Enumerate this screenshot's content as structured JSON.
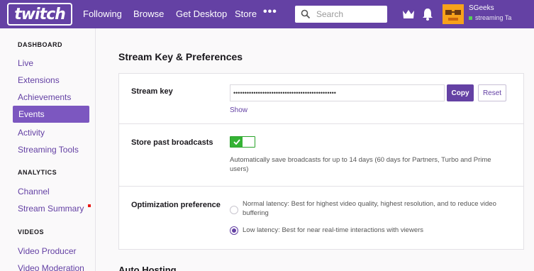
{
  "brand": {
    "logo_text": "twitch",
    "color": "#6441a4"
  },
  "topnav": {
    "links": [
      "Following",
      "Browse",
      "Get Desktop",
      "Store"
    ],
    "more_label": "•••",
    "search_placeholder": "Search",
    "user": {
      "name": "SGeeks",
      "status": "streaming Ta"
    }
  },
  "sidebar": {
    "dashboard_heading": "DASHBOARD",
    "dashboard_items": [
      "Live",
      "Extensions",
      "Achievements",
      "Events",
      "Activity",
      "Streaming Tools"
    ],
    "active_item": "Events",
    "analytics_heading": "ANALYTICS",
    "analytics_items": [
      "Channel",
      "Stream Summary"
    ],
    "videos_heading": "VIDEOS",
    "videos_items": [
      "Video Producer",
      "Video Moderation"
    ]
  },
  "main": {
    "title": "Stream Key & Preferences",
    "stream_key": {
      "label": "Stream key",
      "masked_value": "••••••••••••••••••••••••••••••••••••••••••••••",
      "copy_label": "Copy",
      "reset_label": "Reset",
      "show_label": "Show"
    },
    "store_past": {
      "label": "Store past broadcasts",
      "enabled": true,
      "description": "Automatically save broadcasts for up to 14 days (60 days for Partners, Turbo and Prime users)"
    },
    "optimization": {
      "label": "Optimization preference",
      "options": [
        {
          "text": "Normal latency: Best for highest video quality, highest resolution, and to reduce video buffering",
          "selected": false
        },
        {
          "text": "Low latency: Best for near real-time interactions with viewers",
          "selected": true
        }
      ]
    },
    "next_section_title": "Auto Hosting"
  }
}
